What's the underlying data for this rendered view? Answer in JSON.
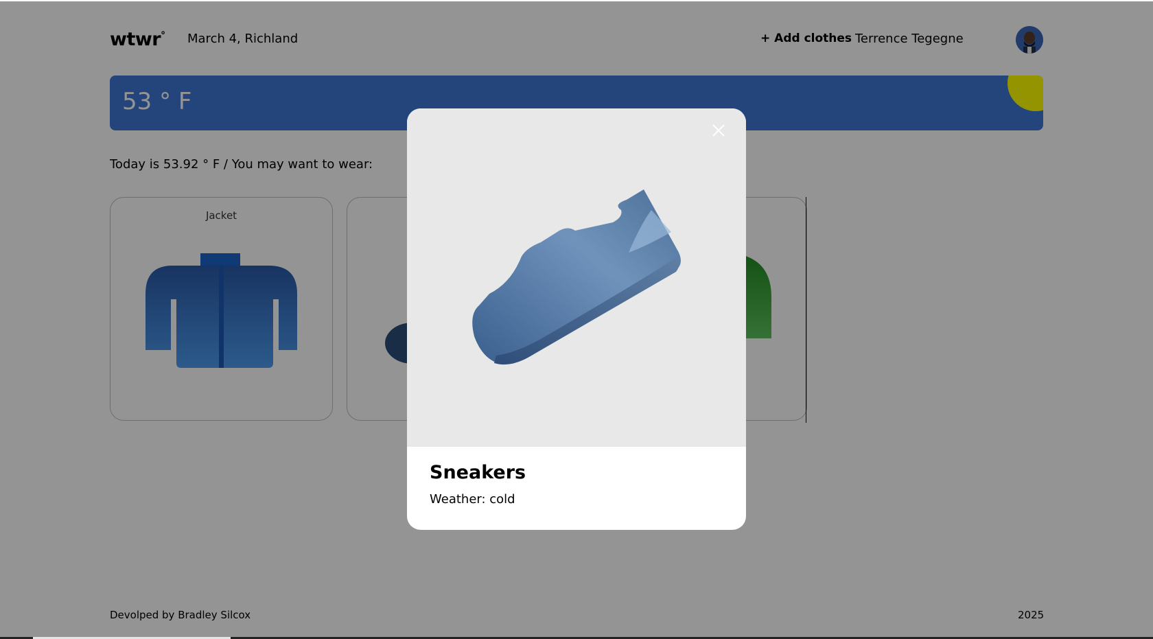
{
  "header": {
    "logo": "wtwr",
    "logo_mark": "°",
    "date_location": "March 4, Richland",
    "add_clothes_label": "+ Add clothes",
    "username": "Terrence Tegegne",
    "avatar_icon": "user-avatar"
  },
  "weather": {
    "temperature": "53 ° F",
    "sun_icon": "sun-icon",
    "card_color": "#3e77d6",
    "sun_color": "#ffff00"
  },
  "main": {
    "today_text": "Today is 53.92 ° F / You may want to wear:",
    "cards": [
      {
        "label": "Jacket",
        "icon": "jacket-icon"
      },
      {
        "label": "",
        "icon": "sneaker-icon"
      },
      {
        "label": "",
        "icon": "green-garment-icon"
      }
    ]
  },
  "modal": {
    "title": "Sneakers",
    "weather_line": "Weather: cold",
    "close_icon": "close-icon",
    "image_icon": "sneaker-icon"
  },
  "footer": {
    "credit": "Devolped by Bradley Silcox",
    "year": "2025"
  },
  "colors": {
    "overlay": "rgba(0,0,0,0.42)",
    "accent_blue": "#3e77d6",
    "modal_bg": "#ffffff"
  }
}
